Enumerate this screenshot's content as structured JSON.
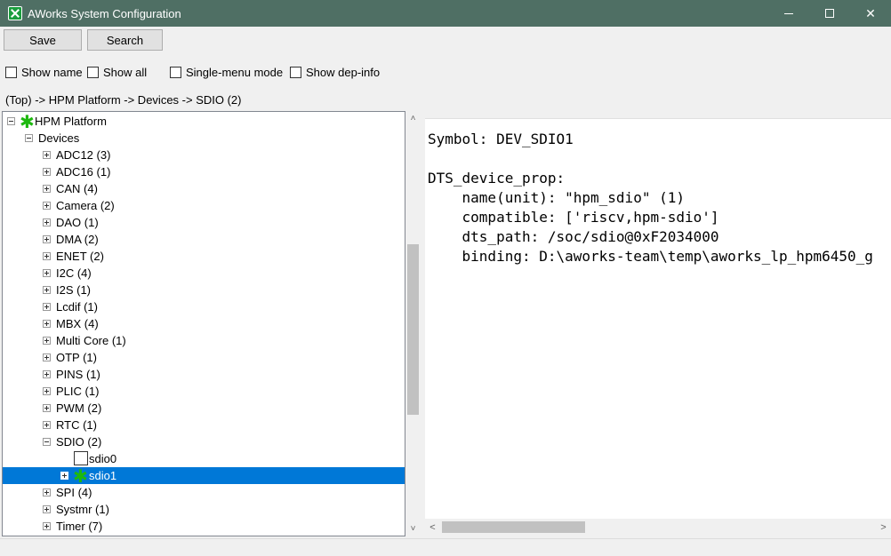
{
  "window": {
    "title": "AWorks System Configuration",
    "app_icon": "aworks-logo-icon",
    "minimize_glyph": "minimize-icon",
    "maximize_glyph": "maximize-icon",
    "close_glyph": "✕"
  },
  "toolbar": {
    "save_label": "Save",
    "search_label": "Search"
  },
  "options": {
    "show_name": "Show name",
    "show_all": "Show all",
    "single_menu": "Single-menu mode",
    "show_dep": "Show dep-info"
  },
  "breadcrumb": "(Top) -> HPM Platform -> Devices -> SDIO (2)",
  "tree": {
    "root": "HPM Platform",
    "devices": "Devices",
    "items": [
      "ADC12 (3)",
      "ADC16 (1)",
      "CAN (4)",
      "Camera (2)",
      "DAO (1)",
      "DMA (2)",
      "ENET (2)",
      "I2C (4)",
      "I2S (1)",
      "Lcdif (1)",
      "MBX (4)",
      "Multi Core (1)",
      "OTP (1)",
      "PINS (1)",
      "PLIC (1)",
      "PWM (2)",
      "RTC (1)",
      "SDIO (2)"
    ],
    "sdio_children": [
      "sdio0",
      "sdio1"
    ],
    "after_items": [
      "SPI (4)",
      "Systmr (1)",
      "Timer (7)"
    ],
    "selected": "sdio1"
  },
  "detail": {
    "lines": [
      "Symbol: DEV_SDIO1",
      "",
      "DTS_device_prop:",
      "    name(unit): \"hpm_sdio\" (1)",
      "    compatible: ['riscv,hpm-sdio']",
      "    dts_path: /soc/sdio@0xF2034000",
      "    binding: D:\\aworks-team\\temp\\aworks_lp_hpm6450_g"
    ]
  },
  "scroll": {
    "up": "˄",
    "down": "˅",
    "left": "<",
    "right": ">"
  },
  "colors": {
    "titlebar": "#4f6f64",
    "selection": "#0078d7",
    "star": "#1db80f"
  }
}
